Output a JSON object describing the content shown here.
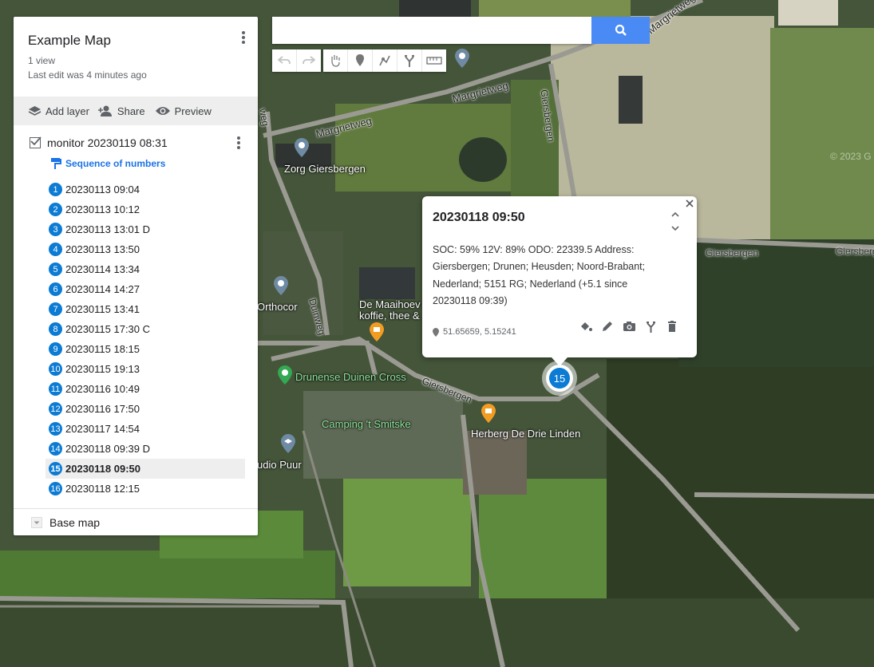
{
  "panel": {
    "title": "Example Map",
    "views": "1 view",
    "last_edit": "Last edit was 4 minutes ago",
    "actions": {
      "add_layer": "Add layer",
      "share": "Share",
      "preview": "Preview"
    },
    "layer": {
      "name": "monitor 20230119 08:31",
      "style_label": "Sequence of numbers",
      "checked": true,
      "items": [
        {
          "num": "1",
          "label": "20230113 09:04"
        },
        {
          "num": "2",
          "label": "20230113 10:12"
        },
        {
          "num": "3",
          "label": "20230113 13:01 D"
        },
        {
          "num": "4",
          "label": "20230113 13:50"
        },
        {
          "num": "5",
          "label": "20230114 13:34"
        },
        {
          "num": "6",
          "label": "20230114 14:27"
        },
        {
          "num": "7",
          "label": "20230115 13:41"
        },
        {
          "num": "8",
          "label": "20230115 17:30 C"
        },
        {
          "num": "9",
          "label": "20230115 18:15"
        },
        {
          "num": "10",
          "label": "20230115 19:13"
        },
        {
          "num": "11",
          "label": "20230116 10:49"
        },
        {
          "num": "12",
          "label": "20230116 17:50"
        },
        {
          "num": "13",
          "label": "20230117 14:54"
        },
        {
          "num": "14",
          "label": "20230118 09:39 D"
        },
        {
          "num": "15",
          "label": "20230118 09:50"
        },
        {
          "num": "16",
          "label": "20230118 12:15"
        }
      ],
      "selected_index": 14
    },
    "base_map": "Base map"
  },
  "search": {
    "value": "",
    "placeholder": ""
  },
  "toolbar": {
    "icons": [
      "undo-icon",
      "redo-icon",
      "hand-icon",
      "marker-icon",
      "draw-line-icon",
      "directions-icon",
      "ruler-icon"
    ]
  },
  "popup": {
    "title": "20230118 09:50",
    "body": "SOC: 59% 12V: 89% ODO: 22339.5 Address: Giersbergen; Drunen; Heusden; Noord-Brabant; Nederland; 5151 RG; Nederland (+5.1 since 20230118 09:39)",
    "coords": "51.65659, 5.15241",
    "tools": [
      "paint-bucket-icon",
      "pencil-icon",
      "camera-icon",
      "directions-icon",
      "trash-icon"
    ]
  },
  "map": {
    "marker_number": "15",
    "places": {
      "zorg": "Zorg Giersbergen",
      "orthocor": "Orthocor",
      "maaihoeve_1": "De Maaihoev",
      "maaihoeve_2": "koffie, thee &",
      "drunense": "Drunense Duinen Cross",
      "camping": "Camping 't Smitske",
      "herberg": "Herberg De Drie Linden",
      "studio": "udio Puur"
    },
    "roads": {
      "margrietweg_top": "Margrietweg",
      "margrietweg_mid": "Margrietweg",
      "margrietweg_left": "Margrietweg",
      "giersbergen_v": "Giersbergen",
      "giersbergen_e1": "Giersbergen",
      "giersbergen_e2": "Giersbergen",
      "giersbergen_s": "Giersbergen",
      "duinweg_left": "weg",
      "duinweg": "Duinweg"
    },
    "copyright": "© 2023 G"
  },
  "colors": {
    "accent": "#1a73e8",
    "marker": "#0b7bd4",
    "search_button": "#4a8af4"
  }
}
